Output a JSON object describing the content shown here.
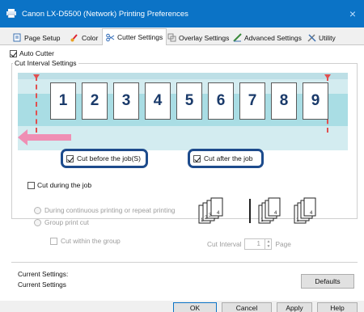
{
  "window": {
    "title": "Canon LX-D5500 (Network) Printing Preferences",
    "close_glyph": "×"
  },
  "tabs": [
    {
      "label": "Page Setup",
      "icon": "page-setup-icon"
    },
    {
      "label": "Color",
      "icon": "color-brush-icon"
    },
    {
      "label": "Cutter Settings",
      "icon": "scissors-icon",
      "active": true
    },
    {
      "label": "Overlay Settings",
      "icon": "overlay-icon"
    },
    {
      "label": "Advanced Settings",
      "icon": "advanced-settings-icon"
    },
    {
      "label": "Utility",
      "icon": "utility-tools-icon"
    }
  ],
  "auto_cutter": {
    "label": "Auto Cutter",
    "checked": true
  },
  "cut_interval": {
    "title": "Cut Interval Settings",
    "pages": [
      "1",
      "2",
      "3",
      "4",
      "5",
      "6",
      "7",
      "8",
      "9"
    ],
    "cut_before": {
      "label": "Cut before the job(S)",
      "checked": true
    },
    "cut_after": {
      "label": "Cut after the job",
      "checked": true
    }
  },
  "cut_during": {
    "label": "Cut during the job",
    "checked": false,
    "options": [
      {
        "label": "During continuous printing or repeat printing"
      },
      {
        "label": "Group print cut"
      }
    ],
    "cut_within_group": "Cut within the group",
    "interval_label": "Cut Interval",
    "interval_value": "1",
    "interval_unit": "Page",
    "stack_a_labels": [
      "1",
      "2",
      "3",
      "4"
    ],
    "stack_b_labels": [
      "1",
      "4"
    ],
    "stack_c_labels": [
      "1",
      "4"
    ]
  },
  "current_settings": {
    "label1": "Current Settings:",
    "label2": "Current Settings",
    "defaults_button": "Defaults"
  },
  "footer": {
    "ok": "OK",
    "cancel": "Cancel",
    "apply": "Apply",
    "help": "Help"
  },
  "colors": {
    "titlebar": "#0b73c6",
    "highlight": "#1d4b8c",
    "cut_line": "#e05050",
    "direction_arrow": "#ef8fb4",
    "paper_band": "#a9dde4"
  }
}
